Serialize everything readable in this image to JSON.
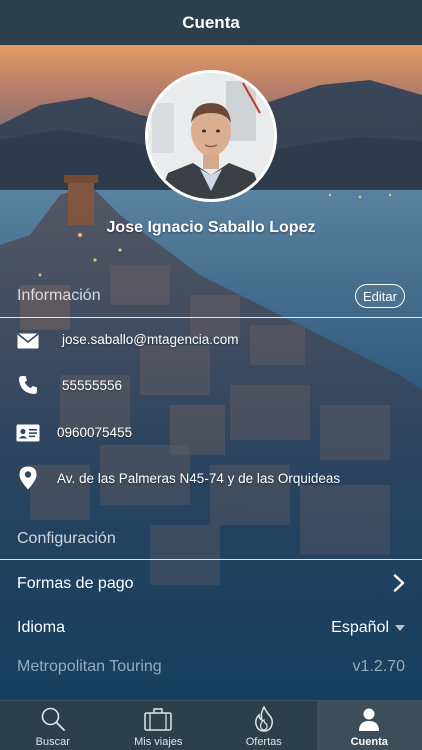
{
  "header": {
    "title": "Cuenta"
  },
  "profile": {
    "name": "Jose Ignacio Saballo Lopez"
  },
  "info_section": {
    "title": "Información",
    "edit_label": "Editar",
    "rows": [
      {
        "icon": "email-icon",
        "text": "jose.saballo@mtagencia.com"
      },
      {
        "icon": "phone-icon",
        "text": "55555556"
      },
      {
        "icon": "id-card-icon",
        "text": "0960075455"
      },
      {
        "icon": "location-pin-icon",
        "text": "Av. de las Palmeras N45-74 y de las Orquideas"
      }
    ]
  },
  "config_section": {
    "title": "Configuración",
    "payment_label": "Formas de pago",
    "language_label": "Idioma",
    "language_value": "Español",
    "app_name": "Metropolitan Touring",
    "app_version": "v1.2.70"
  },
  "tabbar": {
    "tabs": [
      {
        "label": "Buscar",
        "icon": "search-icon",
        "active": false
      },
      {
        "label": "Mis viajes",
        "icon": "suitcase-icon",
        "active": false
      },
      {
        "label": "Ofertas",
        "icon": "flame-icon",
        "active": false
      },
      {
        "label": "Cuenta",
        "icon": "user-icon",
        "active": true
      }
    ]
  }
}
